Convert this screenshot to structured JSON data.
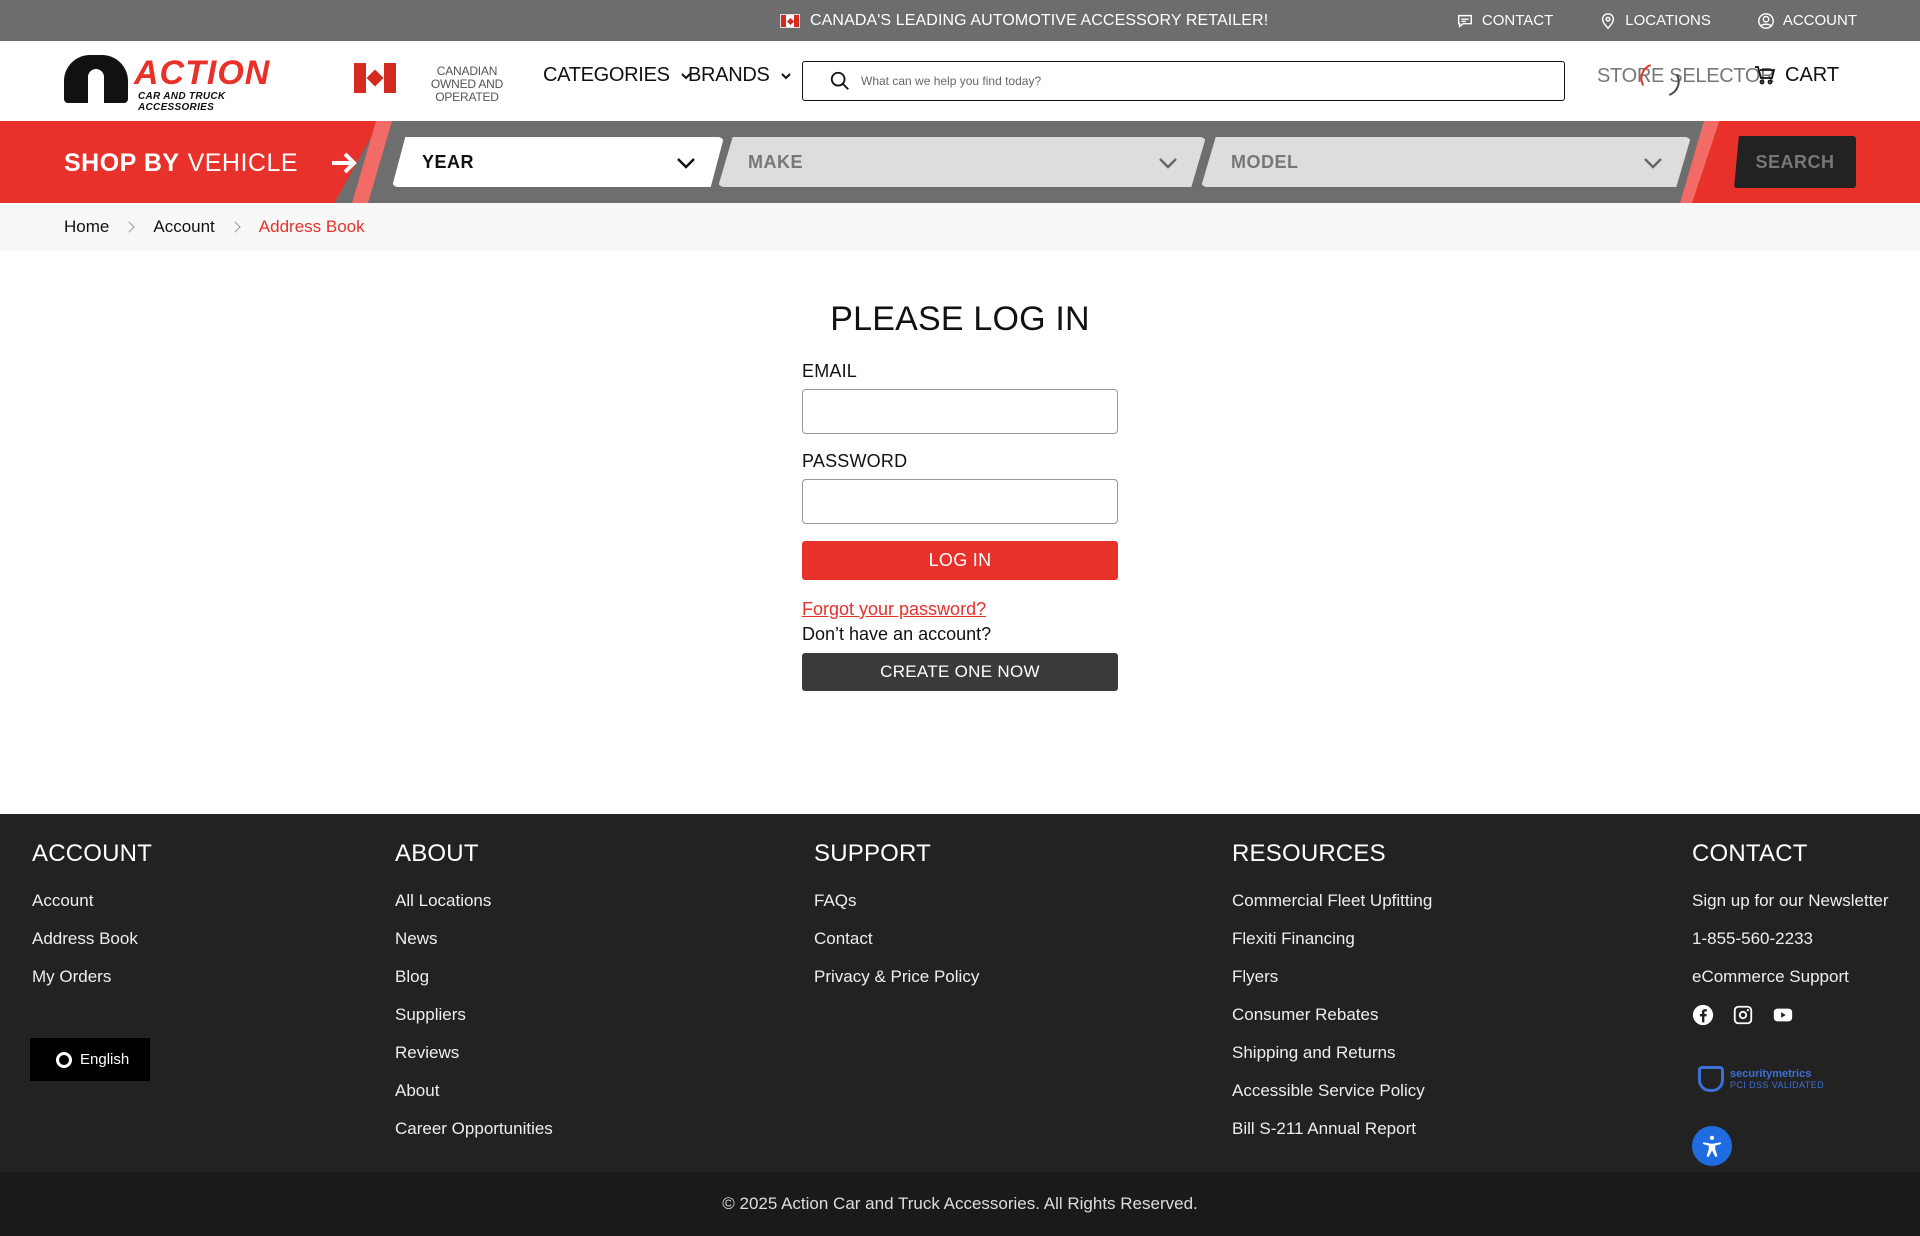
{
  "topbar": {
    "promo": "CANADA'S LEADING AUTOMOTIVE ACCESSORY RETAILER!",
    "links": [
      {
        "label": "CONTACT",
        "icon": "chat-icon"
      },
      {
        "label": "LOCATIONS",
        "icon": "location-pin-icon"
      },
      {
        "label": "ACCOUNT",
        "icon": "user-icon"
      }
    ]
  },
  "header": {
    "logo_word": "ACTION",
    "logo_sub": "CAR AND TRUCK ACCESSORIES",
    "canadian": "CANADIAN OWNED AND OPERATED",
    "nav": [
      {
        "label": "CATEGORIES"
      },
      {
        "label": "BRANDS"
      }
    ],
    "search_placeholder": "What can we help you find today?",
    "store_selector": "STORE SELECTOR",
    "cart": "CART"
  },
  "vehicle": {
    "title_bold": "SHOP BY",
    "title_rest": "VEHICLE",
    "year": "YEAR",
    "make": "MAKE",
    "model": "MODEL",
    "search": "SEARCH"
  },
  "breadcrumb": [
    "Home",
    "Account",
    "Address Book"
  ],
  "login": {
    "title": "PLEASE LOG IN",
    "email_label": "EMAIL",
    "password_label": "PASSWORD",
    "login_button": "LOG IN",
    "forgot": "Forgot your password?",
    "no_account": "Don’t have an account?",
    "create_button": "CREATE ONE NOW"
  },
  "footer": {
    "columns": [
      {
        "title": "ACCOUNT",
        "links": [
          "Account",
          "Address Book",
          "My Orders"
        ]
      },
      {
        "title": "ABOUT",
        "links": [
          "All Locations",
          "News",
          "Blog",
          "Suppliers",
          "Reviews",
          "About",
          "Career Opportunities"
        ]
      },
      {
        "title": "SUPPORT",
        "links": [
          "FAQs",
          "Contact",
          "Privacy & Price Policy"
        ]
      },
      {
        "title": "RESOURCES",
        "links": [
          "Commercial Fleet Upfitting",
          "Flexiti Financing",
          "Flyers",
          "Consumer Rebates",
          "Shipping and Returns",
          "Accessible Service Policy",
          "Bill S-211 Annual Report"
        ]
      },
      {
        "title": "CONTACT",
        "links": [
          "Sign up for our Newsletter",
          "1-855-560-2233",
          "eCommerce Support"
        ]
      }
    ],
    "social": [
      "facebook-icon",
      "instagram-icon",
      "youtube-icon"
    ],
    "security_title": "securitymetrics",
    "security_sub": "PCI DSS VALIDATED",
    "language": "English",
    "copyright": "© 2025 Action Car and Truck Accessories. All Rights Reserved."
  },
  "colors": {
    "accent": "#e8312a",
    "topbar": "#6d6d6d",
    "footer": "#222222"
  }
}
